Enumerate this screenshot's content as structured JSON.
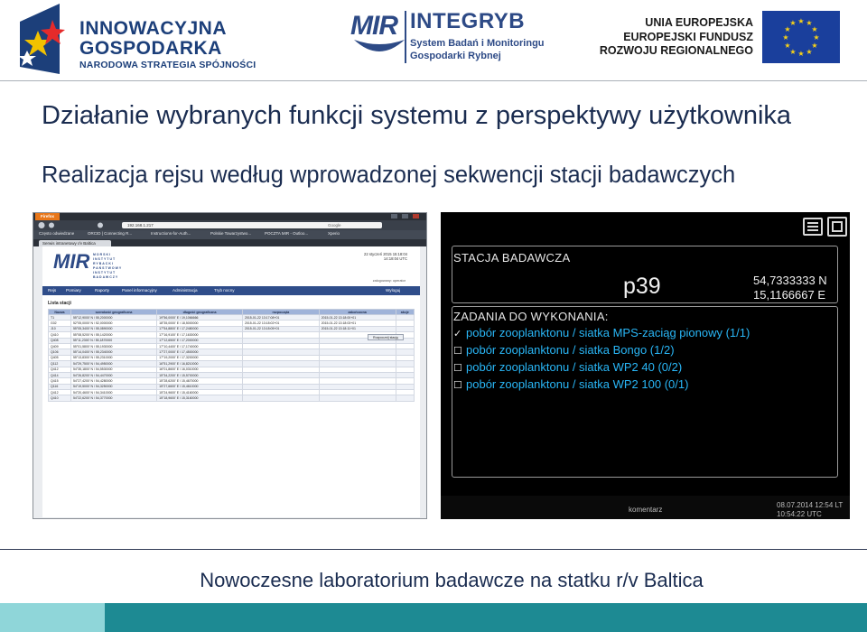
{
  "header": {
    "logo_left": {
      "line1": "INNOWACYJNA",
      "line2": "GOSPODARKA",
      "line3": "NARODOWA STRATEGIA SPÓJNOŚCI"
    },
    "logo_center": {
      "mir": "MIR",
      "name": "INTEGRYB",
      "sub1": "System Badań i Monitoringu",
      "sub2": "Gospodarki Rybnej"
    },
    "logo_right": {
      "line1": "UNIA EUROPEJSKA",
      "line2": "EUROPEJSKI FUNDUSZ",
      "line3": "ROZWOJU REGIONALNEGO"
    }
  },
  "title": "Działanie wybranych funkcji systemu z perspektywy użytkownika",
  "subtitle": "Realizacja rejsu według wprowadzonej sekwencji stacji badawczych",
  "browser": {
    "firefox_label": "Firefox",
    "url": "192.168.1.217",
    "search_placeholder": "Google",
    "bookmarks": [
      "Często odwiedzane",
      "ORCID | Connecting R...",
      "Instructions-for-Auth...",
      "Polskie Towarzystwo...",
      "POCZTA MIR - Outloo...",
      "Xperio"
    ],
    "tab": "Serwis intranetowy r/v Baltica",
    "app": {
      "logo": "MIR",
      "logo_text": [
        "MORSKI",
        "INSTYTUT",
        "RYBACKI",
        "PAŃSTWOWY",
        "INSTYTUT",
        "BADAWCZY"
      ],
      "date_line1": "22 styczeń 2015 15:18:04",
      "date_line2": "14:18:04 UTC",
      "user": "zalogowany: operator",
      "menu": [
        "Rejs",
        "Pomiary",
        "Raporty",
        "Panel informacyjny",
        "Administracja",
        "Tryb nocny"
      ],
      "logout": "Wyloguj",
      "section_title": "Lista stacji",
      "button": "Rozpocznij stację",
      "columns": [
        "Nazwa",
        "szerokość geograficzna",
        "długość geograficzna",
        "rozpoczęta",
        "zakończona",
        "akcje"
      ],
      "rows": [
        [
          "T1",
          "55°12,9000' N / 55,2000000",
          "19°56,0000' E / 19,1066666",
          "2015-01-22 13:17:08+01",
          "2015-01-22 13:18:00+01",
          ""
        ],
        [
          "G02",
          "52°05,0000' N / 52,0000000",
          "18°35,0000' E / 18,5000000",
          "2015-01-22 13:18:02+01",
          "2015-01-22 13:18:03+01",
          ""
        ],
        [
          "J10",
          "55°05,3400' N / 55,0890000",
          "17°54,8800' E / 17,2480000",
          "2015-01-22 13:18:05+01",
          "2015-01-22 13:18:11+01",
          ""
        ],
        [
          "Q410",
          "55°08,5200' N / 55,1420000",
          "17°16,9100' E / 17,1630000",
          "",
          "",
          ""
        ],
        [
          "Q408",
          "55°11,2300' N / 55,1870000",
          "17°12,6500' E / 17,2000000",
          "",
          "",
          ""
        ],
        [
          "Q409",
          "55°01,5800' N / 55,1930000",
          "17°10,4400' E / 17,1740000",
          "",
          "",
          ""
        ],
        [
          "Q106",
          "55°14,0400' N / 55,2340000",
          "17°27,0000' E / 17,4500000",
          "",
          "",
          ""
        ],
        [
          "Q405",
          "55°13,8300' N / 55,2310000",
          "17°19,2000' E / 17,3200000",
          "",
          "",
          ""
        ],
        [
          "Q112",
          "54°29,7500' N / 54,4950000",
          "16°51,2900' E / 16,8210000",
          "",
          "",
          ""
        ],
        [
          "Q412",
          "54°35,1800' N / 54,5530000",
          "16°01,8600' E / 16,0310000",
          "",
          "",
          ""
        ],
        [
          "Q414",
          "54°26,8200' N / 54,4470000",
          "15°34,2200' E / 15,5700000",
          "",
          "",
          ""
        ],
        [
          "Q415",
          "54°27,4200' N / 54,4280000",
          "15°28,6200' E / 15,4670000",
          "",
          "",
          ""
        ],
        [
          "Q116",
          "54°19,5000' N / 54,3250000",
          "15°27,6600' E / 15,4610000",
          "",
          "",
          ""
        ],
        [
          "Q412",
          "54°20,4600' N / 54,3410000",
          "15°24,9600' E / 15,4160000",
          "",
          "",
          ""
        ],
        [
          "Q410",
          "54°22,6200' N / 54,3770000",
          "15°18,9600' E / 15,3160000",
          "",
          "",
          ""
        ]
      ]
    }
  },
  "terminal": {
    "station_label": "STACJA BADAWCZA",
    "station_code": "p39",
    "coord_n": "54,7333333 N",
    "coord_e": "15,1166667 E",
    "tasks_label": "ZADANIA DO WYKONANIA:",
    "tasks": [
      {
        "mark": "✓",
        "text": "pobór zooplanktonu / siatka MPS-zaciąg pionowy (1/1)"
      },
      {
        "mark": "☐",
        "text": "pobór zooplanktonu / siatka Bongo (1/2)"
      },
      {
        "mark": "☐",
        "text": "pobór zooplanktonu / siatka WP2 40 (0/2)"
      },
      {
        "mark": "☐",
        "text": "pobór zooplanktonu / siatka WP2 100 (0/1)"
      }
    ],
    "comment_button": "komentarz",
    "time_local": "08.07.2014 12:54 LT",
    "time_utc": "10:54:22 UTC"
  },
  "footer": {
    "text": "Nowoczesne laboratorium badawcze na statku r/v Baltica"
  },
  "colors": {
    "title": "#1a2c50",
    "footer_bar_dark": "#1d8a93",
    "footer_bar_light": "#8fd6d9",
    "task_text": "#29b6f6"
  }
}
